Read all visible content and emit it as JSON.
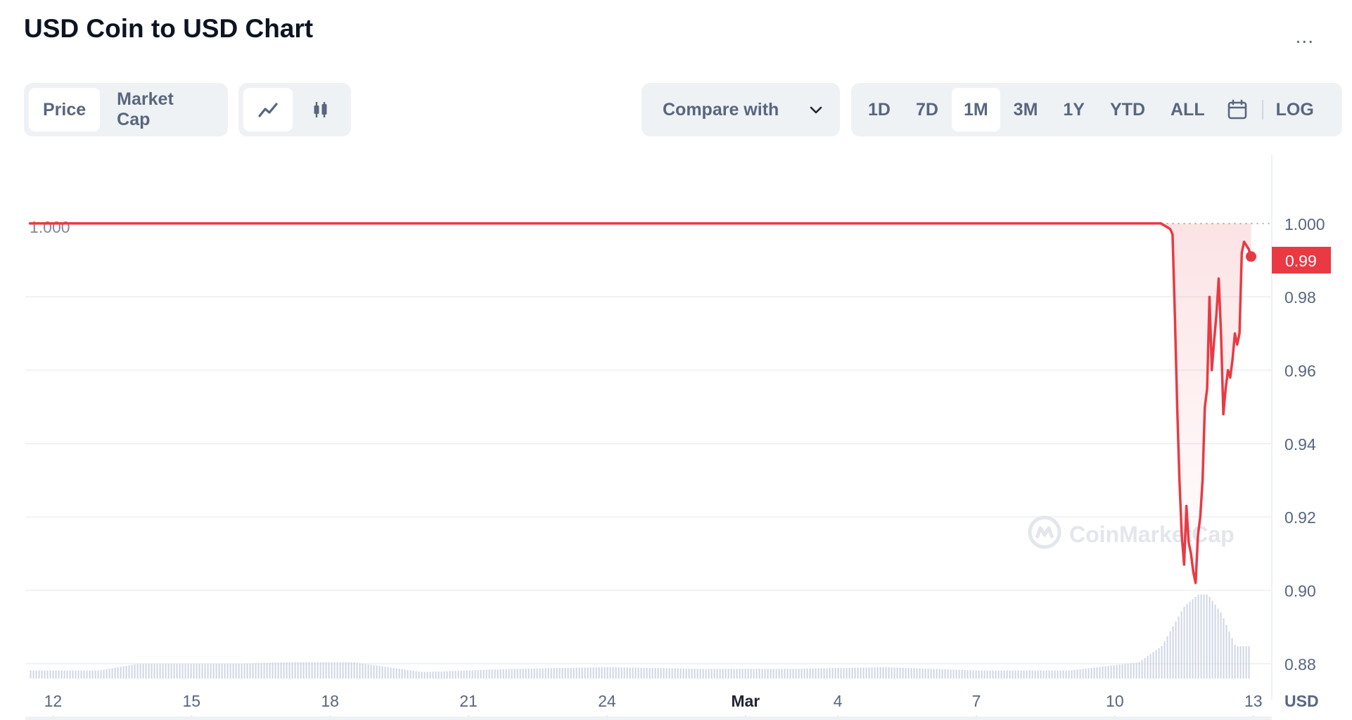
{
  "title": "USD Coin to USD Chart",
  "more_label": "...",
  "type_tabs": [
    {
      "label": "Price",
      "active": true
    },
    {
      "label": "Market Cap",
      "active": false
    }
  ],
  "view_icons": [
    "line-chart-icon",
    "candlestick-icon"
  ],
  "compare": {
    "label": "Compare with",
    "icon": "chevron-down-icon"
  },
  "ranges": [
    {
      "label": "1D",
      "active": false
    },
    {
      "label": "7D",
      "active": false
    },
    {
      "label": "1M",
      "active": true
    },
    {
      "label": "3M",
      "active": false
    },
    {
      "label": "1Y",
      "active": false
    },
    {
      "label": "YTD",
      "active": false
    },
    {
      "label": "ALL",
      "active": false
    }
  ],
  "calendar_icon": "calendar-icon",
  "log_label": "LOG",
  "colors": {
    "up": "#16c784",
    "down": "#ea3943",
    "grid": "#eff2f5",
    "axis_text": "#58667e",
    "volume": "#cfd6e4"
  },
  "watermark": "CoinMarketCap",
  "chart_data": {
    "type": "line",
    "xlabel": "",
    "ylabel": "",
    "currency_label": "USD",
    "x_ticks": [
      "12",
      "15",
      "18",
      "21",
      "24",
      "Mar",
      "4",
      "7",
      "10",
      "13"
    ],
    "x_tick_days": [
      0,
      3,
      6,
      9,
      12,
      15,
      17,
      20,
      23,
      26
    ],
    "xlim_days": [
      -0.6,
      26.4
    ],
    "ylim": [
      0.875,
      1.013
    ],
    "y_ticks": [
      1.0,
      0.98,
      0.96,
      0.94,
      0.92,
      0.9,
      0.88
    ],
    "y_tick_labels": [
      "1.000",
      "0.98",
      "0.96",
      "0.94",
      "0.92",
      "0.90",
      "0.88"
    ],
    "reference_value": 1.0,
    "reference_label": "1.000",
    "current_value": 0.99,
    "current_label": "0.99",
    "series": [
      {
        "values": [
          [
            -0.5,
            1.0
          ],
          [
            2.0,
            1.0
          ],
          [
            4.0,
            1.0
          ],
          [
            6.0,
            1.0
          ],
          [
            8.0,
            1.0
          ],
          [
            10.0,
            1.0
          ],
          [
            12.0,
            1.0
          ],
          [
            14.0,
            1.0
          ],
          [
            16.0,
            1.0
          ],
          [
            18.0,
            1.0
          ],
          [
            20.0,
            1.0
          ],
          [
            22.0,
            1.0
          ],
          [
            23.5,
            1.0
          ],
          [
            24.0,
            1.0
          ],
          [
            24.2,
            0.9985
          ],
          [
            24.25,
            0.997
          ],
          [
            24.3,
            0.975
          ],
          [
            24.35,
            0.95
          ],
          [
            24.4,
            0.93
          ],
          [
            24.45,
            0.915
          ],
          [
            24.5,
            0.907
          ],
          [
            24.55,
            0.923
          ],
          [
            24.6,
            0.913
          ],
          [
            24.65,
            0.91
          ],
          [
            24.7,
            0.905
          ],
          [
            24.75,
            0.902
          ],
          [
            24.8,
            0.915
          ],
          [
            24.85,
            0.92
          ],
          [
            24.9,
            0.93
          ],
          [
            24.95,
            0.95
          ],
          [
            25.0,
            0.955
          ],
          [
            25.05,
            0.98
          ],
          [
            25.1,
            0.96
          ],
          [
            25.15,
            0.968
          ],
          [
            25.2,
            0.975
          ],
          [
            25.25,
            0.985
          ],
          [
            25.3,
            0.97
          ],
          [
            25.35,
            0.948
          ],
          [
            25.4,
            0.955
          ],
          [
            25.45,
            0.96
          ],
          [
            25.5,
            0.958
          ],
          [
            25.55,
            0.963
          ],
          [
            25.6,
            0.97
          ],
          [
            25.65,
            0.967
          ],
          [
            25.7,
            0.97
          ],
          [
            25.75,
            0.992
          ],
          [
            25.8,
            0.995
          ],
          [
            25.9,
            0.993
          ],
          [
            25.95,
            0.991
          ]
        ]
      }
    ],
    "volume_relative": [
      [
        -0.5,
        0.05
      ],
      [
        1.0,
        0.05
      ],
      [
        1.8,
        0.09
      ],
      [
        4.0,
        0.09
      ],
      [
        5.0,
        0.1
      ],
      [
        6.5,
        0.1
      ],
      [
        8.0,
        0.04
      ],
      [
        10.0,
        0.06
      ],
      [
        12.0,
        0.07
      ],
      [
        14.0,
        0.06
      ],
      [
        16.0,
        0.06
      ],
      [
        18.0,
        0.07
      ],
      [
        20.0,
        0.05
      ],
      [
        22.0,
        0.05
      ],
      [
        23.5,
        0.1
      ],
      [
        24.0,
        0.2
      ],
      [
        24.5,
        0.45
      ],
      [
        24.8,
        0.52
      ],
      [
        25.0,
        0.52
      ],
      [
        25.3,
        0.4
      ],
      [
        25.6,
        0.2
      ],
      [
        25.95,
        0.2
      ]
    ]
  }
}
